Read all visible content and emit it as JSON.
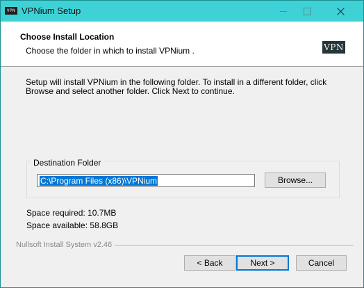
{
  "window": {
    "title": "VPNium  Setup",
    "app_icon_text": "VPN",
    "controls": {
      "minimize": "minimize-icon",
      "maximize": "maximize-icon",
      "close": "close-icon"
    }
  },
  "header": {
    "title": "Choose Install Location",
    "subtitle": "Choose the folder in which to install VPNium .",
    "logo_text": "VPN"
  },
  "body": {
    "intro": "Setup will install VPNium  in the following folder. To install in a different folder, click Browse and select another folder. Click Next to continue.",
    "destination": {
      "legend": "Destination Folder",
      "path": "C:\\Program Files (x86)\\VPNium",
      "browse_label": "Browse..."
    },
    "space_required": "Space required: 10.7MB",
    "space_available": "Space available: 58.8GB"
  },
  "footer": {
    "branding": "Nullsoft Install System v2.46",
    "back_label": "< Back",
    "next_label": "Next >",
    "cancel_label": "Cancel"
  },
  "colors": {
    "titlebar": "#3ed2d6",
    "selection": "#0078d7",
    "logo_bg": "#25363a"
  }
}
